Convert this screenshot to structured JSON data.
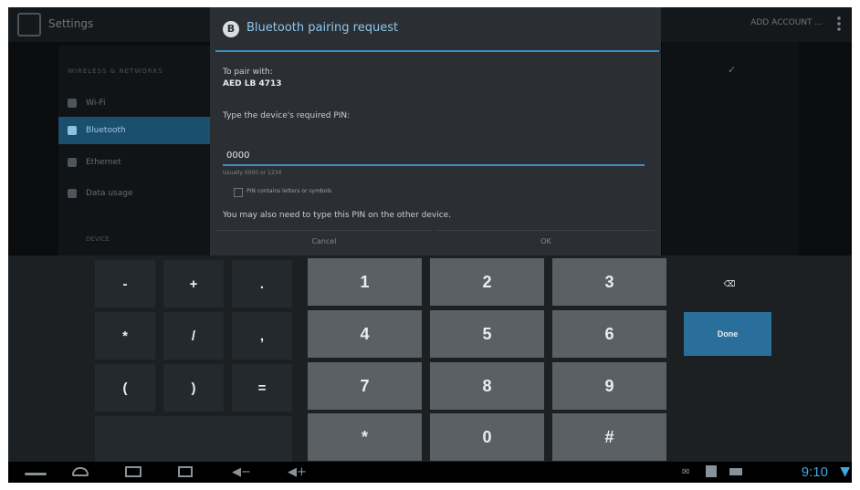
{
  "settings": {
    "title": "Settings",
    "action_link": "ADD ACCOUNT ...",
    "category_header": "WIRELESS & NETWORKS",
    "categories": [
      "Wi-Fi",
      "Bluetooth",
      "Ethernet",
      "Data usage"
    ],
    "device_header": "DEVICE",
    "right_check": "✓"
  },
  "dialog": {
    "title": "Bluetooth pairing request",
    "bt_glyph": "B",
    "pair_label": "To pair with:",
    "device_name": "AED LB 4713",
    "pin_prompt": "Type the device's required PIN:",
    "pin_value": "0000",
    "pin_hint": "Usually 0000 or 1234",
    "checkbox_label": "PIN contains letters or symbols",
    "other_device_note": "You may also need to type this PIN on the other device.",
    "cancel": "Cancel",
    "ok": "OK"
  },
  "keyboard": {
    "symbols": [
      "-",
      "+",
      ".",
      "*",
      "/",
      ",",
      "(",
      ")",
      "="
    ],
    "digits": [
      "1",
      "2",
      "3",
      "4",
      "5",
      "6",
      "7",
      "8",
      "9",
      "*",
      "0",
      "#"
    ],
    "delete_glyph": "⌫",
    "done": "Done"
  },
  "system_bar": {
    "vol_down": "◀−",
    "vol_up": "◀+",
    "notification": "✉",
    "clock": "9:10",
    "wifi_glyph": "▼"
  },
  "icons": [
    "settings-app-icon",
    "overflow-menu-icon",
    "wifi-icon",
    "bluetooth-icon",
    "ethernet-icon",
    "data-usage-icon",
    "backspace-icon",
    "back-icon",
    "home-icon",
    "recent-apps-icon",
    "screenshot-icon",
    "volume-down-icon",
    "volume-up-icon",
    "sd-card-icon",
    "battery-icon"
  ],
  "colors": {
    "accent": "#3a8fc2",
    "selected_category": "#1b4f6e",
    "done_key": "#2a6f9c",
    "clock": "#3ea7e0"
  }
}
